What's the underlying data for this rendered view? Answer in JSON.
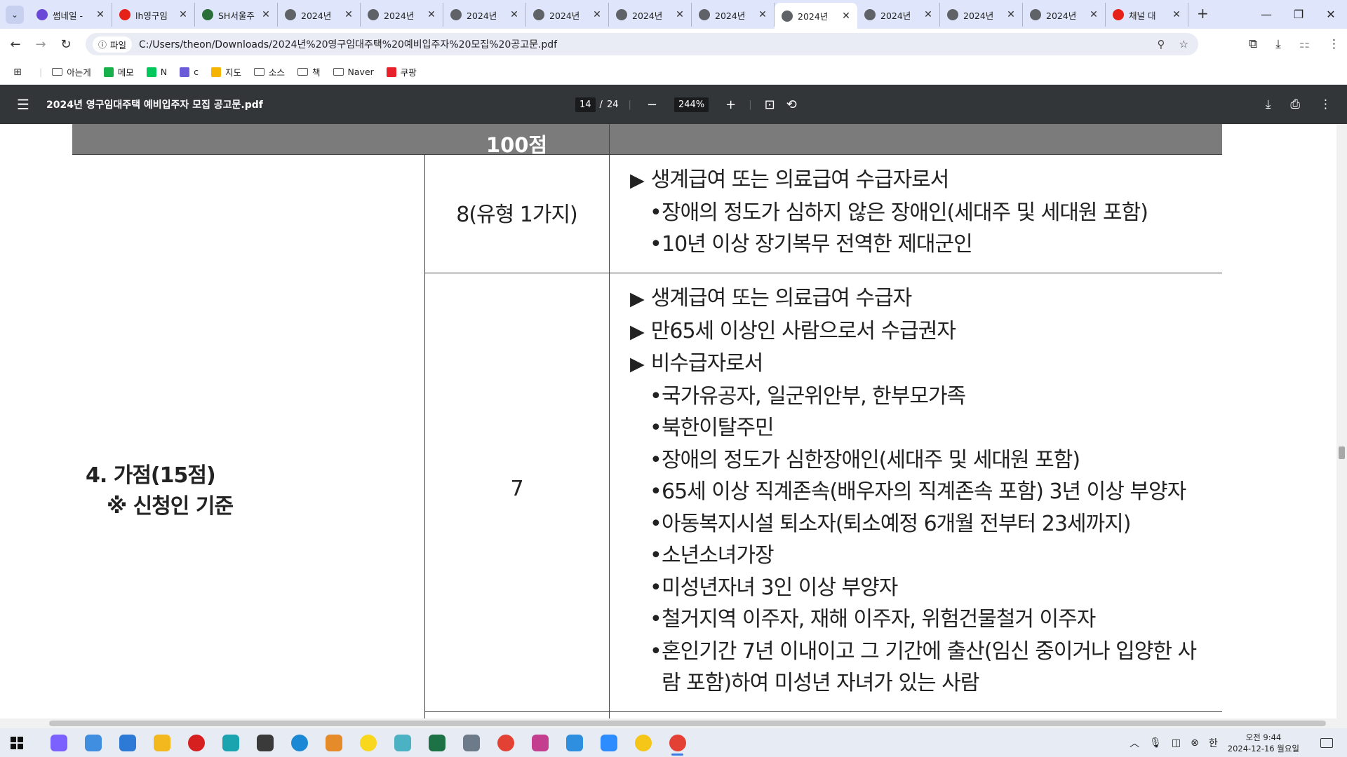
{
  "browser": {
    "tabs": [
      {
        "title": "썸네일 -",
        "color": "#6a47d6"
      },
      {
        "title": "lh영구임",
        "color": "#e62117"
      },
      {
        "title": "SH서울주",
        "color": "#2a6f3a"
      },
      {
        "title": "2024년 ",
        "color": "#5f6368"
      },
      {
        "title": "2024년 ",
        "color": "#5f6368"
      },
      {
        "title": "2024년 ",
        "color": "#5f6368"
      },
      {
        "title": "2024년 ",
        "color": "#5f6368"
      },
      {
        "title": "2024년 ",
        "color": "#5f6368"
      },
      {
        "title": "2024년 ",
        "color": "#5f6368"
      },
      {
        "title": "2024년 ",
        "color": "#5f6368"
      },
      {
        "title": "2024년 ",
        "color": "#5f6368"
      },
      {
        "title": "2024년 ",
        "color": "#5f6368"
      },
      {
        "title": "2024년 ",
        "color": "#5f6368"
      },
      {
        "title": "채널 대",
        "color": "#e62117"
      }
    ],
    "active_tab_index": 9,
    "address": {
      "chip": "파일",
      "url": "C:/Users/theon/Downloads/2024년%20영구임대주택%20예비입주자%20모집%20공고문.pdf"
    },
    "bookmarks": [
      {
        "label": "",
        "icon": "apps-grid-icon",
        "type": "apps"
      },
      {
        "label": "아는게",
        "icon": "folder-icon",
        "type": "folder"
      },
      {
        "label": "메모",
        "icon": "memo-icon",
        "type": "site",
        "color": "#18b04a"
      },
      {
        "label": "N",
        "icon": "naver-icon",
        "type": "site",
        "color": "#03c75a"
      },
      {
        "label": "c",
        "icon": "calendar-icon",
        "type": "site",
        "color": "#6a5cd8"
      },
      {
        "label": "지도",
        "icon": "map-pin-icon",
        "type": "site",
        "color": "#f5b400"
      },
      {
        "label": "소스",
        "icon": "folder-icon",
        "type": "folder"
      },
      {
        "label": "책",
        "icon": "folder-icon",
        "type": "folder"
      },
      {
        "label": "Naver",
        "icon": "folder-icon",
        "type": "folder"
      },
      {
        "label": "쿠팡",
        "icon": "coupang-icon",
        "type": "site",
        "color": "#e8202a"
      }
    ]
  },
  "pdf": {
    "title": "2024년 영구임대주택 예비입주자 모집 공고문.pdf",
    "page_current": "14",
    "page_sep": "/",
    "page_total": "24",
    "zoom": "244%"
  },
  "document": {
    "header_mid": "100점",
    "category_line1": "4. 가점(15점)",
    "category_line2": "※ 신청인 기준",
    "rows": [
      {
        "score": "8(유형 1가지)",
        "items": [
          {
            "type": "main",
            "text": "생계급여 또는 의료급여 수급자로서"
          },
          {
            "type": "sub",
            "text": "장애의 정도가 심하지 않은 장애인(세대주 및 세대원 포함)"
          },
          {
            "type": "sub",
            "text": "10년 이상 장기복무 전역한 제대군인"
          }
        ]
      },
      {
        "score": "7",
        "items": [
          {
            "type": "main",
            "text": "생계급여 또는 의료급여 수급자"
          },
          {
            "type": "main",
            "text": "만65세 이상인 사람으로서 수급권자"
          },
          {
            "type": "main",
            "text": "비수급자로서"
          },
          {
            "type": "sub",
            "text": "국가유공자, 일군위안부, 한부모가족"
          },
          {
            "type": "sub",
            "text": "북한이탈주민"
          },
          {
            "type": "sub",
            "text": "장애의 정도가 심한장애인(세대주 및 세대원 포함)"
          },
          {
            "type": "sub",
            "text": "65세 이상 직계존속(배우자의 직계존속 포함) 3년 이상 부양자"
          },
          {
            "type": "sub",
            "text": "아동복지시설 퇴소자(퇴소예정 6개월 전부터 23세까지)"
          },
          {
            "type": "sub",
            "text": "소년소녀가장"
          },
          {
            "type": "sub",
            "text": "미성년자녀 3인 이상 부양자"
          },
          {
            "type": "sub",
            "text": "철거지역 이주자, 재해 이주자, 위험건물철거 이주자"
          },
          {
            "type": "sub",
            "text": "혼인기간 7년 이내이고 그 기간에 출산(임신 중이거나 입양한 사람 포함)하여 미성년 자녀가 있는 사람"
          }
        ]
      }
    ]
  },
  "taskbar": {
    "apps": [
      {
        "name": "copilot-icon",
        "color": "#7b61ff"
      },
      {
        "name": "explorer-gallery-icon",
        "color": "#3f8ee0"
      },
      {
        "name": "contact-icon",
        "color": "#2d7ad6"
      },
      {
        "name": "file-explorer-icon",
        "color": "#f2b81d"
      },
      {
        "name": "record-icon",
        "color": "#d62020"
      },
      {
        "name": "app-icon",
        "color": "#1aa4b0"
      },
      {
        "name": "davinci-icon",
        "color": "#3a3a3a"
      },
      {
        "name": "edge-icon",
        "color": "#1b88d6"
      },
      {
        "name": "paint-icon",
        "color": "#e58b2a"
      },
      {
        "name": "kakaotalk-icon",
        "color": "#f9d71c"
      },
      {
        "name": "notes-icon",
        "color": "#4bb2c4"
      },
      {
        "name": "excel-icon",
        "color": "#1d7245"
      },
      {
        "name": "calculator-icon",
        "color": "#6d7a8a"
      },
      {
        "name": "chrome-icon",
        "color": "#e34133"
      },
      {
        "name": "snipping-icon",
        "color": "#c43e8f"
      },
      {
        "name": "store-icon",
        "color": "#2e8ee0"
      },
      {
        "name": "zoom-icon",
        "color": "#2d8cff"
      },
      {
        "name": "player-icon",
        "color": "#f5c518"
      },
      {
        "name": "chrome-icon",
        "color": "#e34133",
        "active": true
      }
    ],
    "ime": "한",
    "time": "오전 9:44",
    "date": "2024-12-16 월요일"
  }
}
